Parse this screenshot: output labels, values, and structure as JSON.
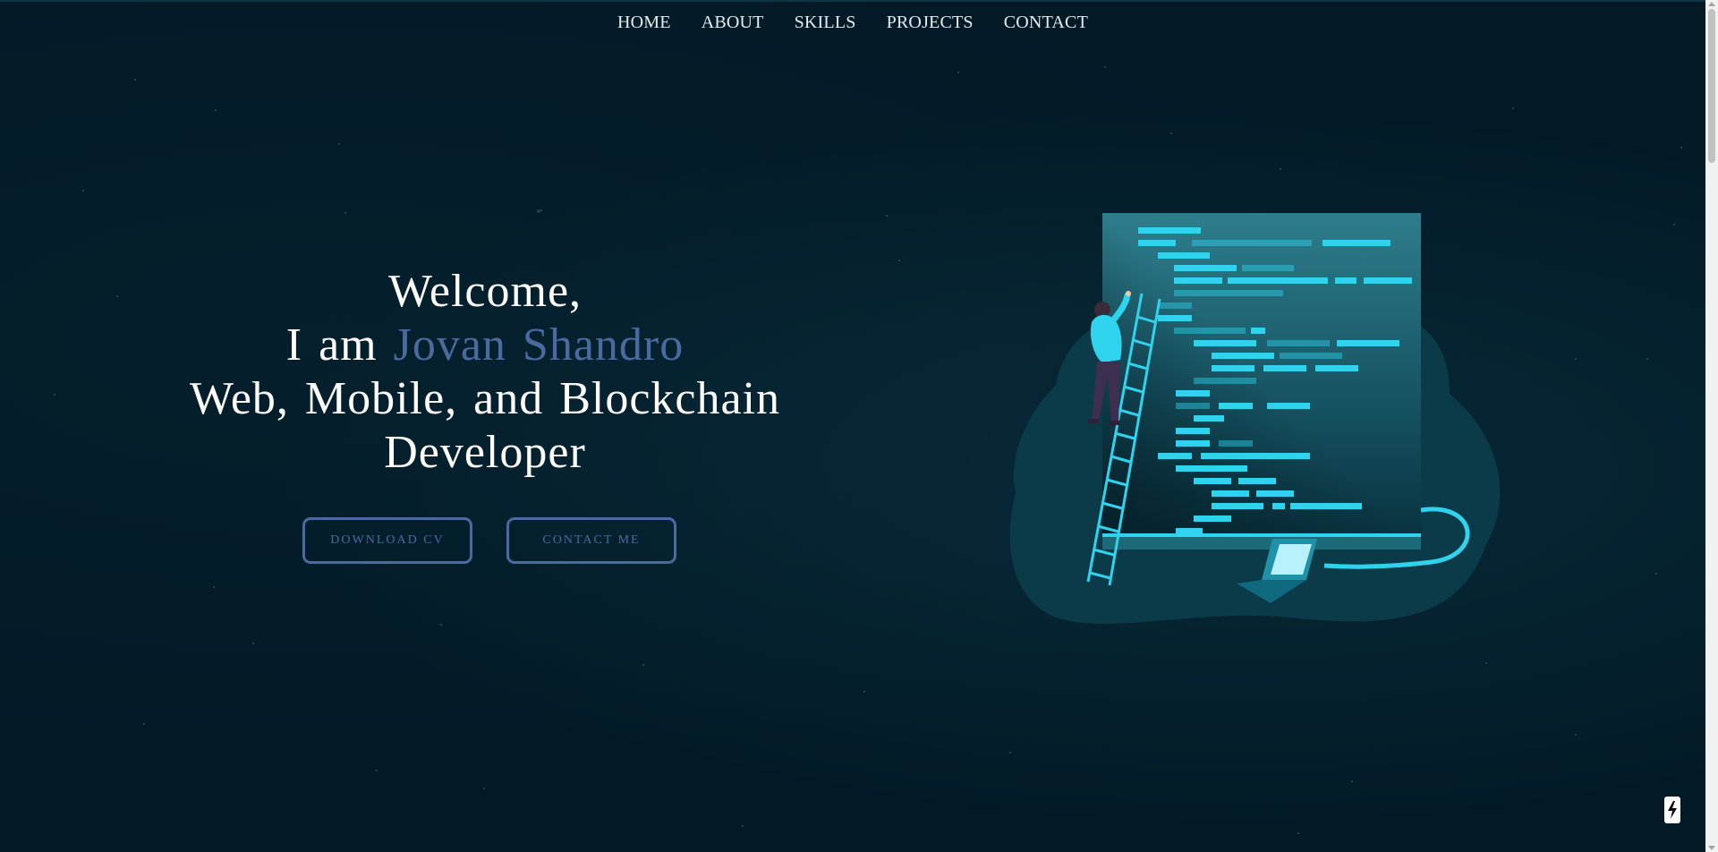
{
  "nav": {
    "items": [
      {
        "label": "HOME"
      },
      {
        "label": "ABOUT"
      },
      {
        "label": "SKILLS"
      },
      {
        "label": "PROJECTS"
      },
      {
        "label": "CONTACT"
      }
    ]
  },
  "hero": {
    "welcome": "Welcome,",
    "intro": "I am",
    "name": "Jovan Shandro",
    "role_line1": "Web, Mobile, and Blockchain",
    "role_line2": "Developer",
    "name_color": "#4a6aa0"
  },
  "buttons": {
    "download_cv": "DOWNLOAD CV",
    "contact_me": "CONTACT ME"
  },
  "illustration": {
    "icon": "developer-climbing-code-illustration"
  },
  "badge": {
    "icon": "lightning-bolt-icon"
  },
  "colors": {
    "background": "#021a26",
    "accent": "#4a6aa0",
    "illustration_teal": "#2fd3ee"
  }
}
